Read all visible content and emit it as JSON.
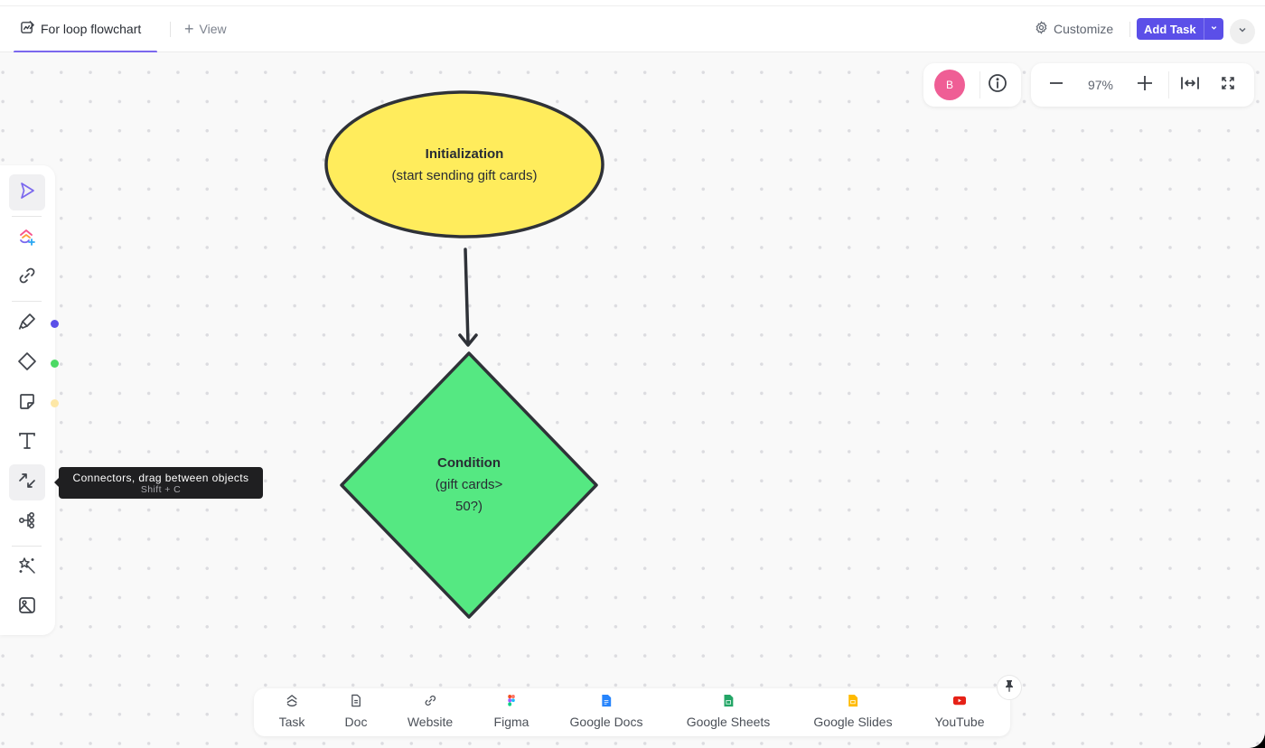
{
  "header": {
    "tab_label": "For loop flowchart",
    "tab_icon": "whiteboard-icon",
    "add_view_label": "View",
    "customize_label": "Customize",
    "add_task_label": "Add Task",
    "accent_color": "#7b68ee",
    "button_color": "#5b4fe8"
  },
  "top_panel": {
    "avatar_initial": "B",
    "avatar_color": "#ef5e95",
    "zoom_level": "97%"
  },
  "toolbar": {
    "tools": [
      {
        "name": "select",
        "icon": "cursor-icon",
        "active": true
      },
      {
        "name": "clickup-ai",
        "icon": "clickup-add-icon"
      },
      {
        "name": "link",
        "icon": "link-icon"
      },
      {
        "name": "pen",
        "icon": "marker-icon",
        "swatch": "#5b4fe8"
      },
      {
        "name": "shape",
        "icon": "diamond-icon",
        "swatch": "#4cd964"
      },
      {
        "name": "sticky-note",
        "icon": "sticky-note-icon",
        "swatch": "#fde7a6"
      },
      {
        "name": "text",
        "icon": "text-icon"
      },
      {
        "name": "connector",
        "icon": "connector-icon",
        "active": true
      },
      {
        "name": "mind-map",
        "icon": "mind-map-icon"
      },
      {
        "name": "ai-magic",
        "icon": "magic-wand-icon"
      },
      {
        "name": "image",
        "icon": "image-icon"
      }
    ],
    "tooltip": {
      "title": "Connectors, drag between objects",
      "shortcut": "Shift + C"
    }
  },
  "flowchart": {
    "nodes": [
      {
        "id": "init",
        "shape": "ellipse",
        "title": "Initialization",
        "subtitle": "(start sending gift cards)",
        "fill": "#ffec5c",
        "stroke": "#2f3238"
      },
      {
        "id": "cond",
        "shape": "diamond",
        "title": "Condition",
        "subtitle_lines": [
          "(gift cards>",
          "50?)"
        ],
        "fill": "#55e882",
        "stroke": "#2f3238"
      }
    ],
    "edges": [
      {
        "from": "init",
        "to": "cond"
      }
    ]
  },
  "bottom_bar": {
    "items": [
      {
        "label": "Task",
        "icon": "task-icon"
      },
      {
        "label": "Doc",
        "icon": "doc-icon"
      },
      {
        "label": "Website",
        "icon": "link-icon"
      },
      {
        "label": "Figma",
        "icon": "figma-icon"
      },
      {
        "label": "Google Docs",
        "icon": "google-docs-icon"
      },
      {
        "label": "Google Sheets",
        "icon": "google-sheets-icon"
      },
      {
        "label": "Google Slides",
        "icon": "google-slides-icon"
      },
      {
        "label": "YouTube",
        "icon": "youtube-icon"
      }
    ]
  }
}
